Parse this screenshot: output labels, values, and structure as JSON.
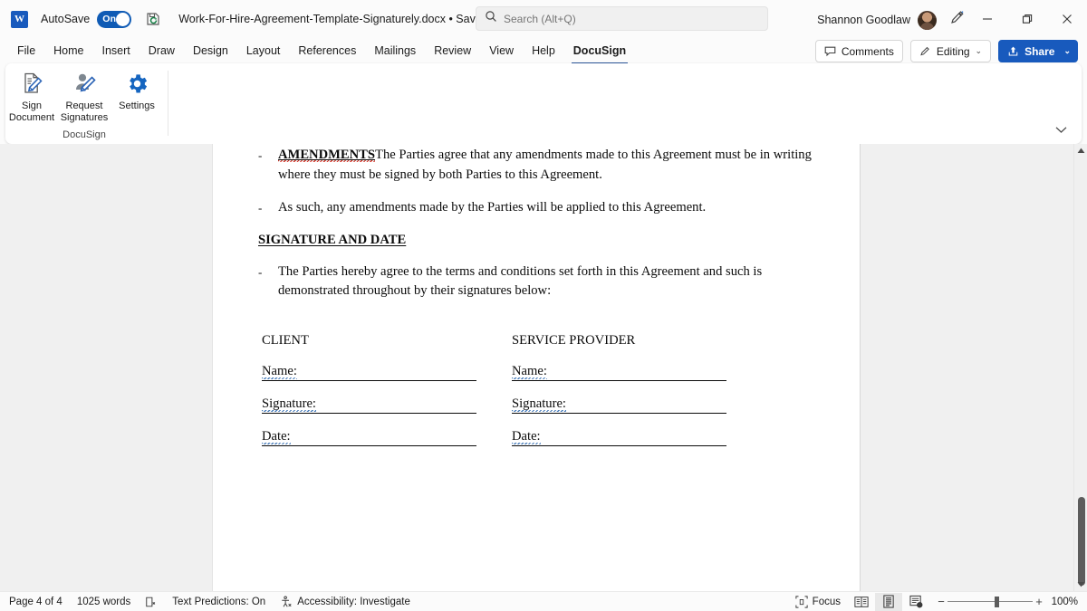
{
  "titlebar": {
    "app_logo": "word-logo",
    "autosave_label": "AutoSave",
    "autosave_state": "On",
    "document_title": "Work-For-Hire-Agreement-Template-Signaturely.docx  •  Saved",
    "title_chevron": "⌄",
    "account_name": "Shannon Goodlaw",
    "minimize": "—",
    "restore": "❐",
    "close": "✕"
  },
  "search": {
    "placeholder": "Search (Alt+Q)",
    "value": ""
  },
  "tabs": [
    {
      "label": "File",
      "active": false
    },
    {
      "label": "Home",
      "active": false
    },
    {
      "label": "Insert",
      "active": false
    },
    {
      "label": "Draw",
      "active": false
    },
    {
      "label": "Design",
      "active": false
    },
    {
      "label": "Layout",
      "active": false
    },
    {
      "label": "References",
      "active": false
    },
    {
      "label": "Mailings",
      "active": false
    },
    {
      "label": "Review",
      "active": false
    },
    {
      "label": "View",
      "active": false
    },
    {
      "label": "Help",
      "active": false
    },
    {
      "label": "DocuSign",
      "active": true
    }
  ],
  "ribbon_right": {
    "comments": "Comments",
    "editing": "Editing",
    "editing_chevron": "⌄",
    "share": "Share",
    "share_chevron": "⌄"
  },
  "ribbon": {
    "group_title": "DocuSign",
    "collapse_chevron": "⌄",
    "items": [
      {
        "label_line1": "Sign",
        "label_line2": "Document",
        "icon": "sign-document-icon"
      },
      {
        "label_line1": "Request",
        "label_line2": "Signatures",
        "icon": "request-signatures-icon"
      },
      {
        "label_line1": "Settings",
        "label_line2": "",
        "icon": "settings-gear-icon"
      }
    ]
  },
  "document": {
    "bullets": [
      {
        "marker": "-",
        "lead": "AMENDMENTS",
        "text": "The Parties agree that any amendments made to this Agreement must be in writing where they must be signed by both Parties to this Agreement."
      },
      {
        "marker": "-",
        "lead": "",
        "text": "As such, any amendments made by the Parties will be applied to this Agreement."
      }
    ],
    "heading": "SIGNATURE AND DATE",
    "bullet3": {
      "marker": "-",
      "text": "The Parties hereby agree to the terms and conditions set forth in this Agreement and such is demonstrated throughout by their signatures below:"
    },
    "signature_blocks": [
      {
        "title": "CLIENT",
        "fields": [
          "Name:",
          "Signature:",
          "Date:"
        ]
      },
      {
        "title": "SERVICE PROVIDER",
        "fields": [
          "Name:",
          "Signature:",
          "Date:"
        ]
      }
    ]
  },
  "statusbar": {
    "page": "Page 4 of 4",
    "words": "1025 words",
    "proofing_icon": "spelling-check-icon",
    "text_predictions": "Text Predictions: On",
    "accessibility_icon": "accessibility-icon",
    "accessibility": "Accessibility: Investigate",
    "focus": "Focus",
    "view_read": "read-mode-icon",
    "view_print": "print-layout-icon",
    "view_web": "web-layout-icon",
    "zoom_out": "−",
    "zoom_in": "+",
    "zoom_value": "100%"
  },
  "colors": {
    "accent": "#185abd",
    "tab_underline": "#2b579a",
    "toggle_on": "#0f5bb5",
    "spell_error": "#d63b2f",
    "grammar_hint": "#4a7ebb"
  }
}
